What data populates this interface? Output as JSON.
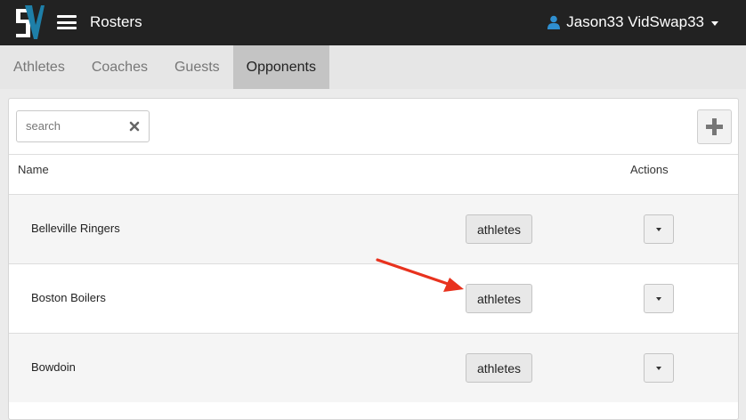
{
  "navbar": {
    "title": "Rosters",
    "user_name": "Jason33 VidSwap33",
    "brand_color": "#222222",
    "logo_color": "#1e7fa8"
  },
  "tabs": [
    {
      "label": "Athletes",
      "active": false
    },
    {
      "label": "Coaches",
      "active": false
    },
    {
      "label": "Guests",
      "active": false
    },
    {
      "label": "Opponents",
      "active": true
    }
  ],
  "search": {
    "placeholder": "search",
    "value": ""
  },
  "table": {
    "columns": [
      "Name",
      "Actions"
    ],
    "rows": [
      {
        "name": "Belleville Ringers",
        "button": "athletes"
      },
      {
        "name": "Boston Boilers",
        "button": "athletes"
      },
      {
        "name": "Bowdoin",
        "button": "athletes"
      }
    ]
  },
  "annotation": {
    "arrow_color": "#e8321e",
    "target": "Boston Boilers athletes button"
  }
}
